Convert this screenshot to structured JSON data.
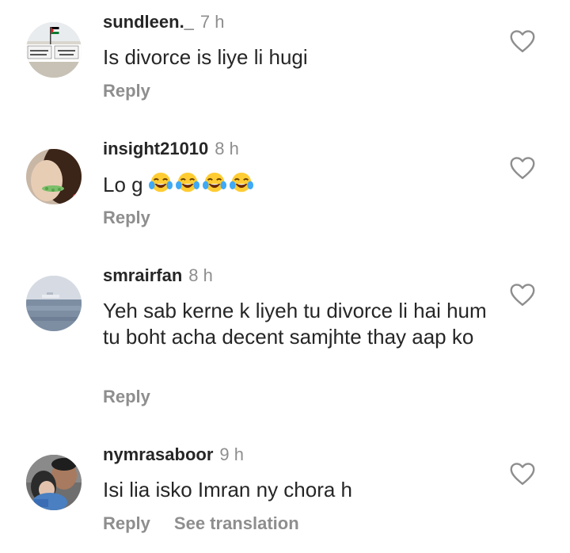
{
  "comments": [
    {
      "username": "sundleen._",
      "time": "7 h",
      "text": "Is divorce is liye li hugi",
      "reply_label": "Reply",
      "avatar_sign_text": "WELCOME TO PALESTINE"
    },
    {
      "username": "insight21010",
      "time": "8 h",
      "text": "Lo g",
      "emojis": [
        "face-with-tears-of-joy",
        "face-with-tears-of-joy",
        "face-with-tears-of-joy",
        "face-with-tears-of-joy"
      ],
      "reply_label": "Reply"
    },
    {
      "username": "smrairfan",
      "time": "8 h",
      "text": "Yeh sab kerne k liyeh tu divorce li hai hum tu boht acha decent samjhte thay aap ko",
      "reply_label": "Reply"
    },
    {
      "username": "nymrasaboor",
      "time": "9 h",
      "text": "Isi lia isko Imran ny chora h",
      "reply_label": "Reply",
      "translation_label": "See translation"
    }
  ],
  "icons": {
    "like": "heart-outline-icon",
    "emoji": "face-with-tears-of-joy"
  },
  "colors": {
    "text": "#262626",
    "secondary": "#8e8e8e",
    "background": "#ffffff"
  }
}
